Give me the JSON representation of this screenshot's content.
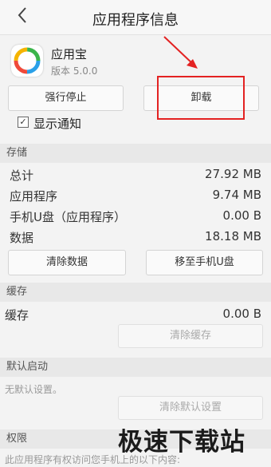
{
  "header": {
    "back_icon": "chevron-left-icon",
    "title": "应用程序信息"
  },
  "app": {
    "name": "应用宝",
    "version": "版本 5.0.0",
    "icon": "app-store-icon"
  },
  "buttons": {
    "force_stop": "强行停止",
    "uninstall": "卸载"
  },
  "notification": {
    "label": "显示通知",
    "checked": true
  },
  "storage": {
    "section_title": "存储",
    "rows": [
      {
        "label": "总计",
        "value": "27.92 MB"
      },
      {
        "label": "应用程序",
        "value": "9.74 MB"
      },
      {
        "label": "手机U盘（应用程序）",
        "value": "0.00 B"
      },
      {
        "label": "数据",
        "value": "18.18 MB"
      }
    ],
    "clear_data": "清除数据",
    "move_to_usb": "移至手机U盘"
  },
  "cache": {
    "section_title": "缓存",
    "label": "缓存",
    "value": "0.00 B",
    "clear_cache": "清除缓存"
  },
  "default_launch": {
    "section_title": "默认启动",
    "hint": "无默认设置。",
    "clear_defaults": "清除默认设置"
  },
  "permissions": {
    "section_title": "权限",
    "hint": "此应用程序有权访问您手机上的以下内容:"
  },
  "watermark": "极速下载站",
  "colors": {
    "annotation_red": "#e32222"
  }
}
